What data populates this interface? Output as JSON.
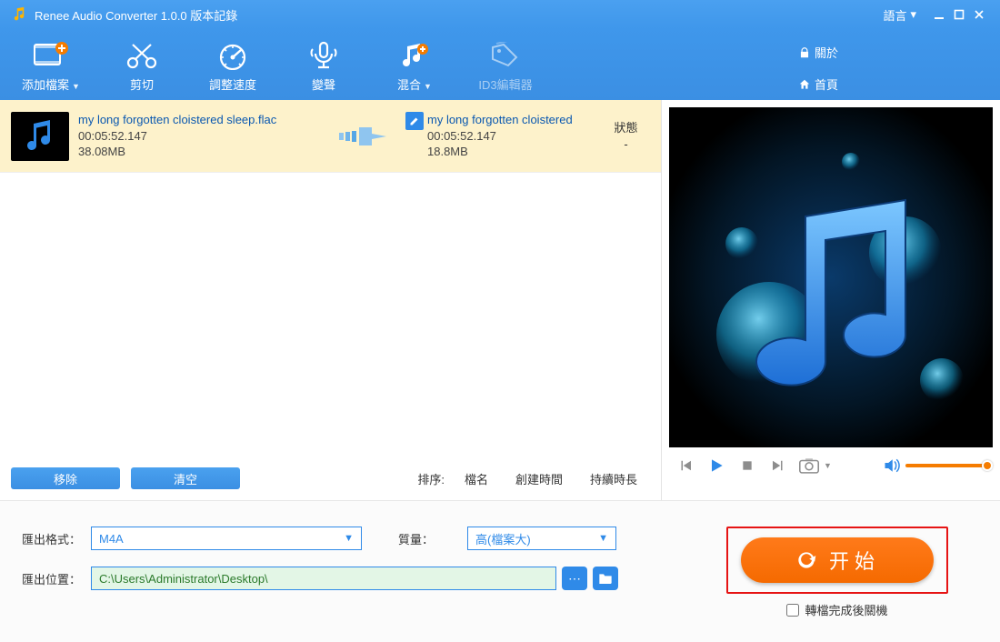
{
  "titlebar": {
    "title": "Renee Audio Converter 1.0.0 版本記錄",
    "language_label": "語言"
  },
  "toolbar": {
    "items": [
      {
        "label": "添加檔案",
        "has_caret": true
      },
      {
        "label": "剪切"
      },
      {
        "label": "調整速度"
      },
      {
        "label": "變聲"
      },
      {
        "label": "混合",
        "has_caret": true
      },
      {
        "label": "ID3編輯器"
      }
    ],
    "about_label": "關於",
    "home_label": "首頁"
  },
  "filelist": {
    "items": [
      {
        "src_name": "my long forgotten cloistered sleep.flac",
        "src_duration": "00:05:52.147",
        "src_size": "38.08MB",
        "out_name": "my long forgotten cloistered",
        "out_duration": "00:05:52.147",
        "out_size": "18.8MB",
        "status_header": "狀態",
        "status_value": "-"
      }
    ]
  },
  "listfooter": {
    "remove_label": "移除",
    "clear_label": "清空",
    "sort_label": "排序:",
    "sort_name": "檔名",
    "sort_time": "創建時間",
    "sort_duration": "持續時長"
  },
  "settings": {
    "format_label": "匯出格式：",
    "format_value": "M4A",
    "quality_label": "質量：",
    "quality_value": "高(檔案大)",
    "output_label": "匯出位置：",
    "output_path": "C:\\Users\\Administrator\\Desktop\\"
  },
  "start": {
    "button_label": "开始",
    "shutdown_label": "轉檔完成後關機"
  }
}
